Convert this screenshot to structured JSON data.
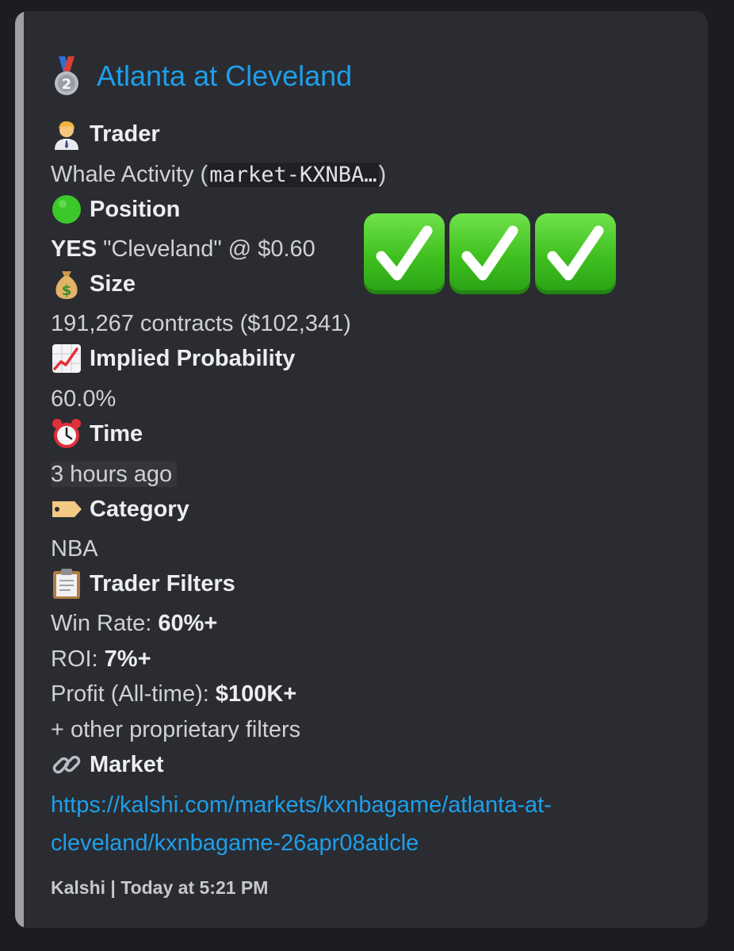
{
  "embed": {
    "title": "Atlanta at Cleveland",
    "fields": {
      "trader": {
        "name": "Trader",
        "value_prefix": "Whale Activity (",
        "value_code": "market-KXNBA…",
        "value_suffix": ")"
      },
      "position": {
        "name": "Position",
        "side": "YES",
        "detail": " \"Cleveland\" @ $0.60"
      },
      "size": {
        "name": "Size",
        "value": "191,267 contracts ($102,341)"
      },
      "implied_probability": {
        "name": "Implied Probability",
        "value": "60.0%"
      },
      "time": {
        "name": "Time",
        "value": "3 hours ago"
      },
      "category": {
        "name": "Category",
        "value": "NBA"
      },
      "trader_filters": {
        "name": "Trader Filters",
        "win_rate_label": "Win Rate: ",
        "win_rate_value": "60%+",
        "roi_label": "ROI: ",
        "roi_value": "7%+",
        "profit_label": "Profit (All-time): ",
        "profit_value": "$100K+",
        "other": "+ other proprietary filters"
      },
      "market": {
        "name": "Market",
        "url_line1": "https://kalshi.com/markets/kxnbagame/atlanta-at-",
        "url_line2": "cleveland/kxnbagame-26apr08atlcle"
      }
    },
    "footer": "Kalshi | Today at 5:21 PM"
  },
  "icons": {
    "title": "second-place-medal-icon",
    "trader": "man-office-worker-icon",
    "position": "green-circle-icon",
    "size": "money-bag-icon",
    "implied_probability": "chart-increasing-icon",
    "time": "alarm-clock-icon",
    "category": "label-tag-icon",
    "trader_filters": "clipboard-icon",
    "market": "link-icon",
    "overlay": "check-mark-button-icon"
  },
  "colors": {
    "background": "#1c1d20",
    "embed_background": "#2a2c31",
    "embed_accent_bar": "#9ea0a6",
    "link": "#1e9fea",
    "check_green": "#3fbf1f"
  }
}
